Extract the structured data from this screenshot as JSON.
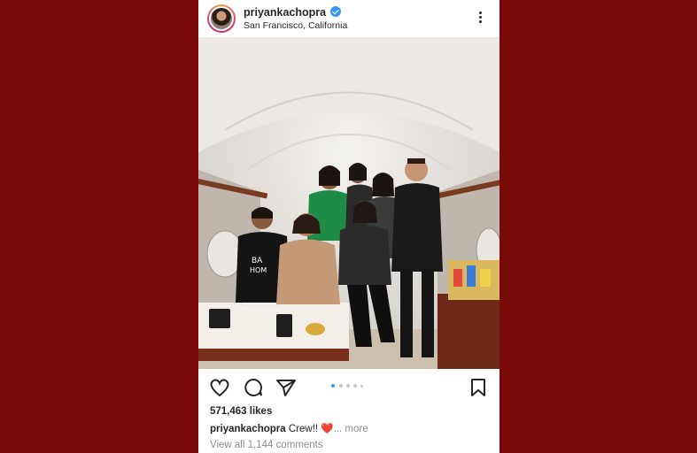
{
  "colors": {
    "background": "#7a0a0a",
    "verified_badge": "#3897f0",
    "active_dot": "#3897f0"
  },
  "post": {
    "username": "priyankachopra",
    "verified": true,
    "location": "San Francisco, California",
    "likes": "571,463 likes",
    "caption": {
      "username": "priyankachopra",
      "text": "Crew!!",
      "emoji": "❤️",
      "more": "... more"
    },
    "comments_link": "View all 1,144 comments",
    "carousel": {
      "total": 5,
      "active": 1
    }
  },
  "icons": {
    "like": "heart-icon",
    "comment": "comment-icon",
    "share": "paper-plane-icon",
    "save": "bookmark-icon",
    "options": "more-options-icon",
    "verified": "verified-badge-icon"
  }
}
